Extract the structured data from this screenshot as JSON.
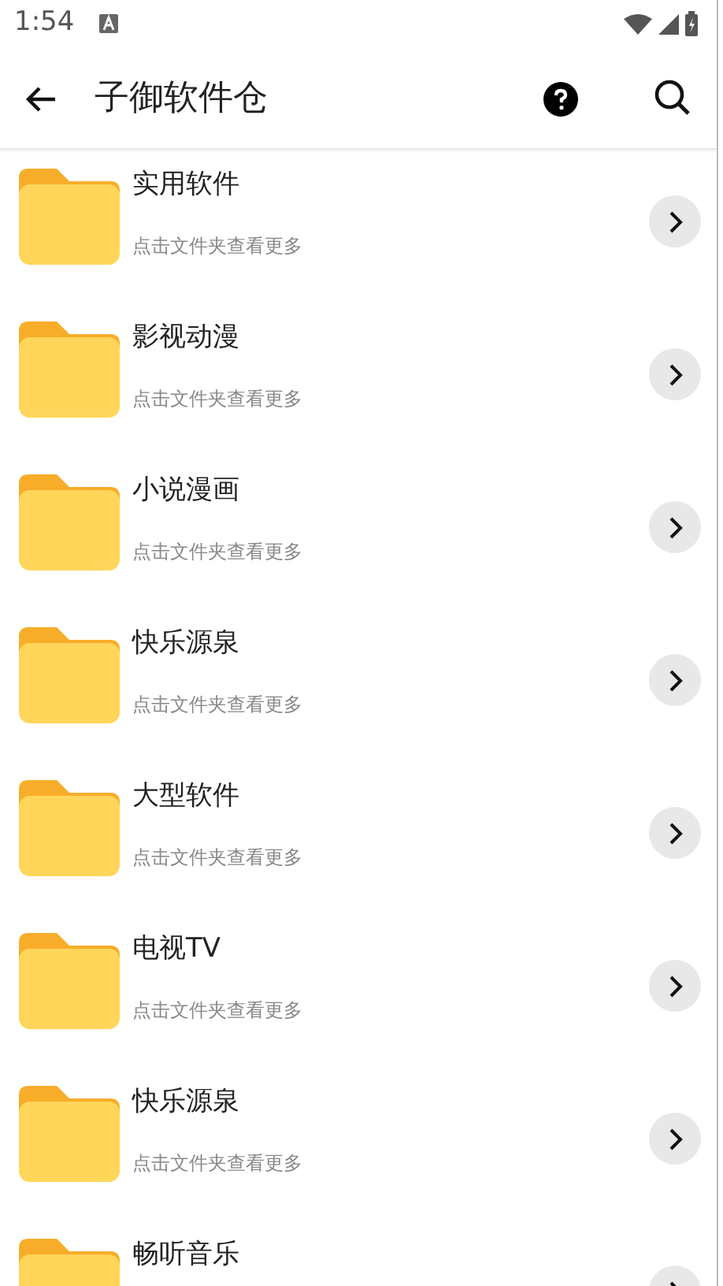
{
  "status_bar": {
    "time": "1:54"
  },
  "app_bar": {
    "title": "子御软件仓"
  },
  "folders": [
    {
      "name": "实用软件",
      "hint": "点击文件夹查看更多"
    },
    {
      "name": "影视动漫",
      "hint": "点击文件夹查看更多"
    },
    {
      "name": "小说漫画",
      "hint": "点击文件夹查看更多"
    },
    {
      "name": "快乐源泉",
      "hint": "点击文件夹查看更多"
    },
    {
      "name": "大型软件",
      "hint": "点击文件夹查看更多"
    },
    {
      "name": "电视TV",
      "hint": "点击文件夹查看更多"
    },
    {
      "name": "快乐源泉",
      "hint": "点击文件夹查看更多"
    },
    {
      "name": "畅听音乐"
    }
  ]
}
